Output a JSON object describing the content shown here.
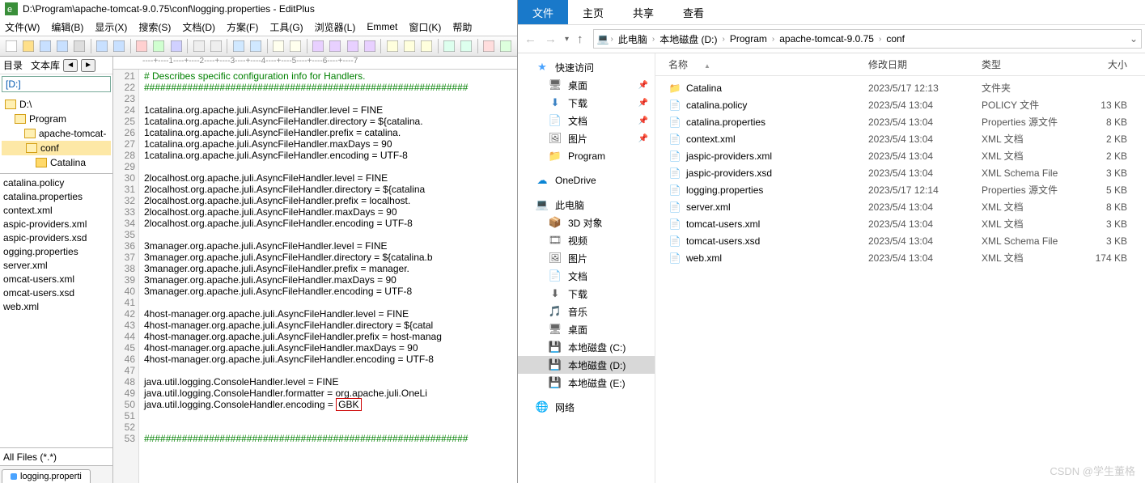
{
  "editplus": {
    "title": "D:\\Program\\apache-tomcat-9.0.75\\conf\\logging.properties - EditPlus",
    "menu": [
      "文件(W)",
      "编辑(B)",
      "显示(X)",
      "搜索(S)",
      "文档(D)",
      "方案(F)",
      "工具(G)",
      "浏览器(L)",
      "Emmet",
      "窗口(K)",
      "帮助"
    ],
    "side_dir": "目录",
    "side_lib": "文本库",
    "drive": "[D:]",
    "tree": [
      {
        "label": "D:\\",
        "indent": 0,
        "open": true
      },
      {
        "label": "Program",
        "indent": 1,
        "open": true
      },
      {
        "label": "apache-tomcat-",
        "indent": 2,
        "open": true
      },
      {
        "label": "conf",
        "indent": 3,
        "open": true,
        "sel": true
      },
      {
        "label": "Catalina",
        "indent": 4,
        "open": false
      }
    ],
    "files": [
      "catalina.policy",
      "catalina.properties",
      "context.xml",
      "aspic-providers.xml",
      "aspic-providers.xsd",
      "ogging.properties",
      "server.xml",
      "omcat-users.xml",
      "omcat-users.xsd",
      "web.xml"
    ],
    "filter": "All Files (*.*)",
    "tab": "logging.properti",
    "ruler": "----+----1----+----2----+----3----+----4----+----5----+----6----+----7",
    "code_start": 21,
    "code": [
      {
        "t": "# Describes specific configuration info for Handlers.",
        "c": true
      },
      {
        "t": "############################################################",
        "c": true
      },
      {
        "t": ""
      },
      {
        "t": "1catalina.org.apache.juli.AsyncFileHandler.level = FINE"
      },
      {
        "t": "1catalina.org.apache.juli.AsyncFileHandler.directory = ${catalina."
      },
      {
        "t": "1catalina.org.apache.juli.AsyncFileHandler.prefix = catalina."
      },
      {
        "t": "1catalina.org.apache.juli.AsyncFileHandler.maxDays = 90"
      },
      {
        "t": "1catalina.org.apache.juli.AsyncFileHandler.encoding = UTF-8"
      },
      {
        "t": ""
      },
      {
        "t": "2localhost.org.apache.juli.AsyncFileHandler.level = FINE"
      },
      {
        "t": "2localhost.org.apache.juli.AsyncFileHandler.directory = ${catalina"
      },
      {
        "t": "2localhost.org.apache.juli.AsyncFileHandler.prefix = localhost."
      },
      {
        "t": "2localhost.org.apache.juli.AsyncFileHandler.maxDays = 90"
      },
      {
        "t": "2localhost.org.apache.juli.AsyncFileHandler.encoding = UTF-8"
      },
      {
        "t": ""
      },
      {
        "t": "3manager.org.apache.juli.AsyncFileHandler.level = FINE"
      },
      {
        "t": "3manager.org.apache.juli.AsyncFileHandler.directory = ${catalina.b"
      },
      {
        "t": "3manager.org.apache.juli.AsyncFileHandler.prefix = manager."
      },
      {
        "t": "3manager.org.apache.juli.AsyncFileHandler.maxDays = 90"
      },
      {
        "t": "3manager.org.apache.juli.AsyncFileHandler.encoding = UTF-8"
      },
      {
        "t": ""
      },
      {
        "t": "4host-manager.org.apache.juli.AsyncFileHandler.level = FINE"
      },
      {
        "t": "4host-manager.org.apache.juli.AsyncFileHandler.directory = ${catal"
      },
      {
        "t": "4host-manager.org.apache.juli.AsyncFileHandler.prefix = host-manag"
      },
      {
        "t": "4host-manager.org.apache.juli.AsyncFileHandler.maxDays = 90"
      },
      {
        "t": "4host-manager.org.apache.juli.AsyncFileHandler.encoding = UTF-8"
      },
      {
        "t": ""
      },
      {
        "t": "java.util.logging.ConsoleHandler.level = FINE"
      },
      {
        "t": "java.util.logging.ConsoleHandler.formatter = org.apache.juli.OneLi"
      },
      {
        "t": "java.util.logging.ConsoleHandler.encoding = ",
        "hl": "GBK"
      },
      {
        "t": ""
      },
      {
        "t": ""
      },
      {
        "t": "############################################################",
        "c": true
      }
    ]
  },
  "explorer": {
    "tabs": [
      "文件",
      "主页",
      "共享",
      "查看"
    ],
    "path": [
      "此电脑",
      "本地磁盘 (D:)",
      "Program",
      "apache-tomcat-9.0.75",
      "conf"
    ],
    "side": [
      {
        "grp": [
          {
            "l": "快速访问",
            "i": "★",
            "c": "#4aa3ff"
          },
          {
            "l": "桌面",
            "i": "🖥",
            "lvl": 1,
            "pin": true
          },
          {
            "l": "下载",
            "i": "⬇",
            "c": "#3b82c4",
            "lvl": 1,
            "pin": true
          },
          {
            "l": "文档",
            "i": "📄",
            "lvl": 1,
            "pin": true
          },
          {
            "l": "图片",
            "i": "🖼",
            "lvl": 1,
            "pin": true
          },
          {
            "l": "Program",
            "i": "📁",
            "c": "#ffd96a",
            "lvl": 1
          }
        ]
      },
      {
        "grp": [
          {
            "l": "OneDrive",
            "i": "☁",
            "c": "#0a84d4"
          }
        ]
      },
      {
        "grp": [
          {
            "l": "此电脑",
            "i": "💻",
            "c": "#3b82c4"
          },
          {
            "l": "3D 对象",
            "i": "📦",
            "lvl": 1
          },
          {
            "l": "视频",
            "i": "🎞",
            "lvl": 1
          },
          {
            "l": "图片",
            "i": "🖼",
            "lvl": 1
          },
          {
            "l": "文档",
            "i": "📄",
            "lvl": 1
          },
          {
            "l": "下载",
            "i": "⬇",
            "lvl": 1
          },
          {
            "l": "音乐",
            "i": "🎵",
            "lvl": 1
          },
          {
            "l": "桌面",
            "i": "🖥",
            "lvl": 1
          },
          {
            "l": "本地磁盘 (C:)",
            "i": "💾",
            "lvl": 1
          },
          {
            "l": "本地磁盘 (D:)",
            "i": "💾",
            "lvl": 1,
            "sel": true
          },
          {
            "l": "本地磁盘 (E:)",
            "i": "💾",
            "lvl": 1
          }
        ]
      },
      {
        "grp": [
          {
            "l": "网络",
            "i": "🌐",
            "c": "#3b82c4"
          }
        ]
      }
    ],
    "cols": [
      "名称",
      "修改日期",
      "类型",
      "大小"
    ],
    "rows": [
      {
        "n": "Catalina",
        "d": "2023/5/17 12:13",
        "t": "文件夹",
        "s": "",
        "folder": true
      },
      {
        "n": "catalina.policy",
        "d": "2023/5/4 13:04",
        "t": "POLICY 文件",
        "s": "13 KB"
      },
      {
        "n": "catalina.properties",
        "d": "2023/5/4 13:04",
        "t": "Properties 源文件",
        "s": "8 KB"
      },
      {
        "n": "context.xml",
        "d": "2023/5/4 13:04",
        "t": "XML 文档",
        "s": "2 KB"
      },
      {
        "n": "jaspic-providers.xml",
        "d": "2023/5/4 13:04",
        "t": "XML 文档",
        "s": "2 KB"
      },
      {
        "n": "jaspic-providers.xsd",
        "d": "2023/5/4 13:04",
        "t": "XML Schema File",
        "s": "3 KB"
      },
      {
        "n": "logging.properties",
        "d": "2023/5/17 12:14",
        "t": "Properties 源文件",
        "s": "5 KB"
      },
      {
        "n": "server.xml",
        "d": "2023/5/4 13:04",
        "t": "XML 文档",
        "s": "8 KB"
      },
      {
        "n": "tomcat-users.xml",
        "d": "2023/5/4 13:04",
        "t": "XML 文档",
        "s": "3 KB"
      },
      {
        "n": "tomcat-users.xsd",
        "d": "2023/5/4 13:04",
        "t": "XML Schema File",
        "s": "3 KB"
      },
      {
        "n": "web.xml",
        "d": "2023/5/4 13:04",
        "t": "XML 文档",
        "s": "174 KB"
      }
    ]
  },
  "watermark": "CSDN @学生董格"
}
